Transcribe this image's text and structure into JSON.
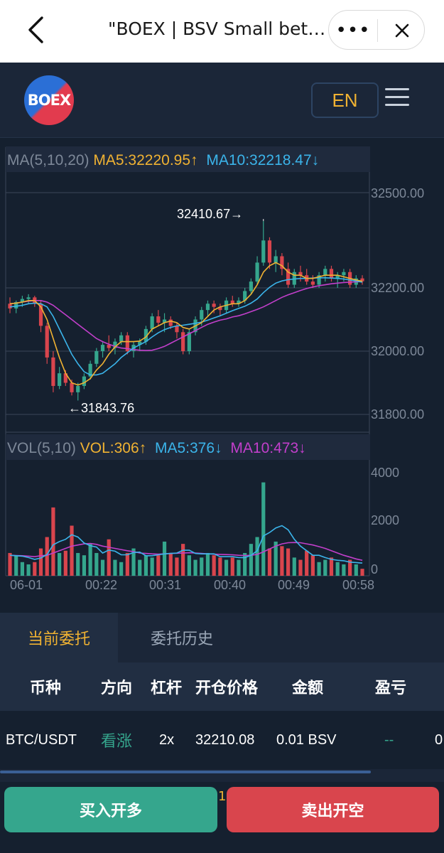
{
  "topbar": {
    "title": "\"BOEX | BSV Small bet | BSV Betting | Bitcoin SV",
    "more_label": "•••"
  },
  "header": {
    "logo_text": "BOEX",
    "lang": "EN"
  },
  "chart": {
    "ma_legend": {
      "title": "MA(5,10,20)",
      "ma5": "MA5:32220.95↑",
      "ma10": "MA10:32218.47↓"
    },
    "vol_legend": {
      "title": "VOL(5,10)",
      "vol": "VOL:306↑",
      "ma5": "MA5:376↓",
      "ma10": "MA10:473↓"
    },
    "high_label": "32410.67→",
    "low_label": "←31843.76",
    "price_ticks": [
      "32500.00",
      "32200.00",
      "32000.00",
      "31800.00"
    ],
    "vol_ticks": [
      "4000",
      "2000",
      "0"
    ],
    "time_ticks": [
      "06-01",
      "00:22",
      "00:31",
      "00:40",
      "00:49",
      "00:58"
    ]
  },
  "colors": {
    "up": "#35a68d",
    "down": "#d9454d",
    "ma5": "#f0b232",
    "ma10": "#3bb4ea",
    "ma20": "#c23fcb"
  },
  "chart_data": {
    "type": "candlestick",
    "ylim": [
      31750,
      32620
    ],
    "vol_ylim": [
      0,
      4400
    ],
    "candles": [
      [
        32150,
        32170,
        32120,
        32135,
        1000
      ],
      [
        32135,
        32160,
        32120,
        32155,
        900
      ],
      [
        32155,
        32175,
        32140,
        32165,
        600
      ],
      [
        32165,
        32180,
        32150,
        32170,
        500
      ],
      [
        32170,
        32175,
        32140,
        32150,
        600
      ],
      [
        32150,
        32160,
        32060,
        32080,
        1200
      ],
      [
        32080,
        32090,
        31960,
        31980,
        1700
      ],
      [
        31980,
        32000,
        31870,
        31890,
        3000
      ],
      [
        31890,
        31950,
        31880,
        31930,
        1000
      ],
      [
        31930,
        31940,
        31890,
        31900,
        1100
      ],
      [
        31900,
        31910,
        31860,
        31870,
        2200
      ],
      [
        31870,
        31900,
        31844,
        31890,
        1000
      ],
      [
        31890,
        31930,
        31880,
        31920,
        900
      ],
      [
        31920,
        31970,
        31910,
        31960,
        1400
      ],
      [
        31960,
        32010,
        31950,
        32000,
        1000
      ],
      [
        32000,
        32030,
        31980,
        32020,
        700
      ],
      [
        32020,
        32050,
        32000,
        32010,
        1600
      ],
      [
        32010,
        32040,
        31990,
        32030,
        700
      ],
      [
        32030,
        32060,
        32020,
        32050,
        600
      ],
      [
        32050,
        32060,
        31990,
        32000,
        1000
      ],
      [
        32000,
        32030,
        31980,
        32020,
        1200
      ],
      [
        32020,
        32040,
        32000,
        32030,
        700
      ],
      [
        32030,
        32080,
        32020,
        32070,
        900
      ],
      [
        32070,
        32120,
        32060,
        32110,
        800
      ],
      [
        32110,
        32130,
        32080,
        32090,
        900
      ],
      [
        32090,
        32120,
        32060,
        32100,
        1500
      ],
      [
        32100,
        32110,
        32070,
        32080,
        1000
      ],
      [
        32080,
        32090,
        32040,
        32060,
        800
      ],
      [
        32060,
        32070,
        31990,
        32000,
        1400
      ],
      [
        32000,
        32070,
        31990,
        32060,
        900
      ],
      [
        32060,
        32110,
        32050,
        32100,
        700
      ],
      [
        32100,
        32140,
        32080,
        32130,
        800
      ],
      [
        32130,
        32160,
        32110,
        32150,
        1000
      ],
      [
        32150,
        32160,
        32120,
        32140,
        900
      ],
      [
        32140,
        32150,
        32110,
        32130,
        800
      ],
      [
        32130,
        32170,
        32120,
        32160,
        700
      ],
      [
        32160,
        32175,
        32140,
        32150,
        800
      ],
      [
        32150,
        32170,
        32140,
        32160,
        700
      ],
      [
        32160,
        32200,
        32150,
        32190,
        1000
      ],
      [
        32190,
        32230,
        32180,
        32220,
        1400
      ],
      [
        32220,
        32300,
        32210,
        32280,
        1700
      ],
      [
        32280,
        32411,
        32270,
        32350,
        4100
      ],
      [
        32350,
        32360,
        32260,
        32280,
        1200
      ],
      [
        32280,
        32320,
        32250,
        32300,
        1500
      ],
      [
        32300,
        32310,
        32240,
        32260,
        1300
      ],
      [
        32260,
        32280,
        32200,
        32210,
        1200
      ],
      [
        32210,
        32260,
        32200,
        32250,
        800
      ],
      [
        32250,
        32270,
        32220,
        32240,
        700
      ],
      [
        32240,
        32260,
        32210,
        32220,
        1100
      ],
      [
        32220,
        32240,
        32200,
        32210,
        900
      ],
      [
        32210,
        32250,
        32200,
        32240,
        600
      ],
      [
        32240,
        32270,
        32220,
        32260,
        700
      ],
      [
        32260,
        32270,
        32220,
        32230,
        800
      ],
      [
        32230,
        32250,
        32200,
        32240,
        600
      ],
      [
        32240,
        32260,
        32220,
        32250,
        500
      ],
      [
        32250,
        32260,
        32200,
        32210,
        700
      ],
      [
        32210,
        32240,
        32200,
        32230,
        500
      ],
      [
        32230,
        32240,
        32210,
        32221,
        306
      ]
    ],
    "ma5": [
      32150,
      32152,
      32155,
      32160,
      32160,
      32140,
      32100,
      32040,
      31980,
      31930,
      31900,
      31893,
      31900,
      31913,
      31940,
      31960,
      31990,
      32013,
      32030,
      32030,
      32030,
      32032,
      32045,
      32070,
      32080,
      32090,
      32095,
      32090,
      32075,
      32070,
      32080,
      32090,
      32110,
      32130,
      32140,
      32145,
      32150,
      32150,
      32160,
      32180,
      32210,
      32250,
      32270,
      32280,
      32270,
      32250,
      32240,
      32240,
      32230,
      32230,
      32235,
      32240,
      32240,
      32240,
      32235,
      32230,
      32225,
      32221
    ],
    "ma10": [
      32140,
      32142,
      32145,
      32150,
      32152,
      32150,
      32140,
      32110,
      32070,
      32030,
      31990,
      31960,
      31935,
      31925,
      31925,
      31930,
      31945,
      31960,
      31980,
      31995,
      32010,
      32020,
      32030,
      32045,
      32058,
      32068,
      32075,
      32080,
      32082,
      32085,
      32088,
      32092,
      32098,
      32105,
      32112,
      32120,
      32128,
      32135,
      32142,
      32152,
      32165,
      32185,
      32202,
      32215,
      32222,
      32226,
      32228,
      32230,
      32230,
      32231,
      32232,
      32232,
      32231,
      32230,
      32228,
      32225,
      32222,
      32218
    ],
    "ma20": [
      32150,
      32152,
      32155,
      32158,
      32160,
      32160,
      32155,
      32145,
      32130,
      32115,
      32100,
      32085,
      32070,
      32055,
      32040,
      32030,
      32022,
      32015,
      32010,
      32008,
      32005,
      32003,
      32002,
      32003,
      32008,
      32015,
      32025,
      32035,
      32045,
      32055,
      32065,
      32075,
      32085,
      32092,
      32098,
      32102,
      32108,
      32112,
      32118,
      32125,
      32132,
      32140,
      32150,
      32160,
      32170,
      32178,
      32185,
      32192,
      32198,
      32203,
      32207,
      32210,
      32213,
      32215,
      32217,
      32218,
      32219,
      32220
    ],
    "vol_ma5": [
      900,
      880,
      860,
      800,
      720,
      780,
      930,
      1360,
      1500,
      1600,
      1800,
      1700,
      1440,
      1320,
      1260,
      1000,
      1130,
      1080,
      920,
      920,
      1020,
      1040,
      880,
      880,
      920,
      960,
      980,
      1000,
      1120,
      1120,
      980,
      960,
      960,
      960,
      840,
      840,
      840,
      800,
      800,
      900,
      1100,
      1750,
      1900,
      2100,
      2200,
      2020,
      1600,
      1300,
      1100,
      900,
      900,
      800,
      720,
      680,
      660,
      600,
      580,
      560
    ],
    "vol_ma10": [
      900,
      890,
      880,
      860,
      840,
      880,
      900,
      1000,
      1100,
      1200,
      1300,
      1350,
      1400,
      1420,
      1380,
      1300,
      1250,
      1200,
      1150,
      1100,
      1060,
      1000,
      980,
      960,
      950,
      960,
      980,
      990,
      1000,
      1010,
      1000,
      980,
      960,
      950,
      940,
      930,
      920,
      900,
      890,
      900,
      940,
      1050,
      1180,
      1300,
      1400,
      1450,
      1460,
      1450,
      1400,
      1350,
      1280,
      1200,
      1100,
      1000,
      900,
      820,
      740,
      680
    ]
  },
  "orders": {
    "tabs": [
      "当前委托",
      "委托历史"
    ],
    "headers": [
      "币种",
      "方向",
      "杠杆",
      "开仓价格",
      "金额",
      "盈亏"
    ],
    "row": {
      "symbol": "BTC/USDT",
      "direction": "看涨",
      "leverage": "2x",
      "open_price": "32210.08",
      "amount": "0.01 BSV",
      "pnl": "--",
      "extra": "0"
    },
    "buy_label": "买入开多",
    "sell_label": "卖出开空",
    "peek_text": "1"
  }
}
